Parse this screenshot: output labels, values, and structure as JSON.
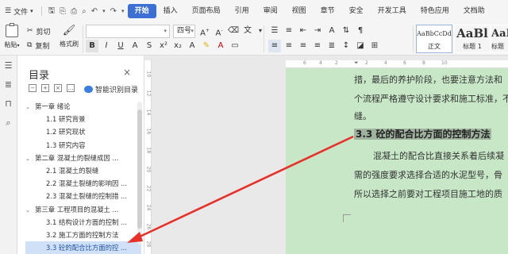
{
  "menu": {
    "file_label": "文件",
    "tabs": [
      "开始",
      "插入",
      "页面布局",
      "引用",
      "审阅",
      "视图",
      "章节",
      "安全",
      "开发工具",
      "特色应用",
      "文档助"
    ]
  },
  "ribbon": {
    "paste_label": "粘贴",
    "cut_label": "剪切",
    "copy_label": "复制",
    "format_painter_label": "格式刷",
    "font_name": "",
    "font_size": "四号",
    "styles": [
      {
        "sample": "AaBbCcDd",
        "name": "正文"
      },
      {
        "sample": "AaBl",
        "name": "标题 1"
      },
      {
        "sample": "AaBl",
        "name": "标题"
      }
    ]
  },
  "nav": {
    "title": "目录",
    "smart_label": "智能识别目录",
    "items": [
      {
        "text": "第一章  绪论",
        "level": 1
      },
      {
        "text": "1.1  研究背景",
        "level": 2
      },
      {
        "text": "1.2  研究现状",
        "level": 2
      },
      {
        "text": "1.3  研究内容",
        "level": 2
      },
      {
        "text": "第二章  混凝土的裂缝成因 ...",
        "level": 1
      },
      {
        "text": "2.1 混凝土的裂缝",
        "level": 2
      },
      {
        "text": "2.2 混凝土裂缝的影响因 ...",
        "level": 2
      },
      {
        "text": "2.3 混凝土裂缝的控制措 ...",
        "level": 2
      },
      {
        "text": "第三章  工程项目的混凝土 ...",
        "level": 1
      },
      {
        "text": "3.1 结构设计方面的控制 ...",
        "level": 2
      },
      {
        "text": "3.2 施工方面的控制方法",
        "level": 2
      },
      {
        "text": "3.3 砼的配合比方面的控 ...",
        "level": 2,
        "selected": true
      }
    ]
  },
  "ruler": {
    "horizontal": [
      "6",
      "4",
      "2",
      "",
      "2",
      "4",
      "6",
      "8",
      "10"
    ],
    "vertical": [
      "10",
      "12",
      "14",
      "16",
      "18",
      "20",
      "22",
      "24",
      "26",
      "28"
    ]
  },
  "document": {
    "lines_before": [
      "措，最后的养护阶段，也要注意方法和",
      "个流程严格遵守设计要求和施工标准，不",
      "缝。"
    ],
    "heading_number": "3.3",
    "heading_text": "砼的配合比方面的控制方法",
    "lines_after": [
      "混凝土的配合比直接关系着后续凝",
      "需的强度要求选择合适的水泥型号，骨",
      "所以选择之前要对工程项目施工地的质"
    ]
  },
  "colors": {
    "accent": "#3b6fd6",
    "page_bg": "#c7e7c7",
    "selection": "#cfe0f7",
    "annotation_arrow": "#e8302a"
  }
}
